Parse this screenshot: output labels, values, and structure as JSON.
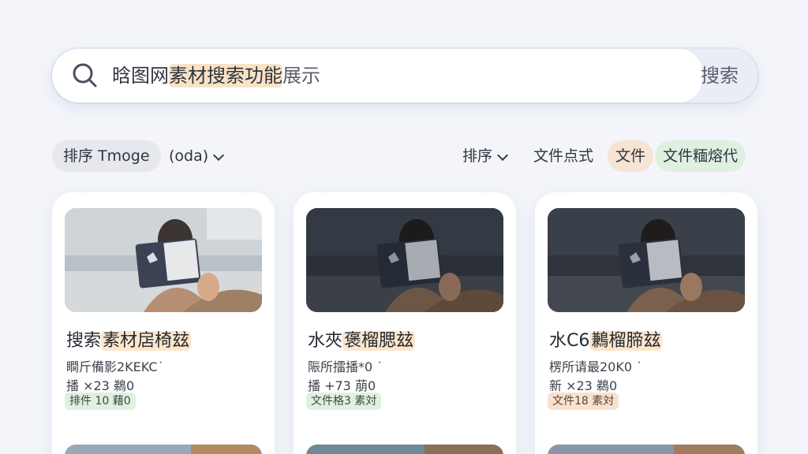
{
  "search": {
    "query_prefix": "晗图网",
    "query_highlight": "素材搜索功能",
    "query_suffix": "展示",
    "button_label": "搜索"
  },
  "filters": {
    "sort_image": "排序 Tmoge",
    "code": "(oda)",
    "sort": "排序",
    "format": "文件点式",
    "file": "文件",
    "file_format": "文件糆熔代"
  },
  "cards": [
    {
      "title_plain": "搜索",
      "title_highlight": "素材扂椅玆",
      "meta1": "瞷斤備影2KEKC˙",
      "meta2": "播 ×23 鵜0",
      "tag": "排件 10 藉0",
      "tag_color": "green"
    },
    {
      "title_plain": "水夾",
      "title_highlight": "褒榴腮玆",
      "meta1": "陙所擂播*0 ˙",
      "meta2": "播 +73 萠0",
      "tag": "文件格3 素対",
      "tag_color": "green"
    },
    {
      "title_plain": "水C6",
      "title_highlight": "鶼榴腣玆",
      "meta1": "楞所请最20K0 ˙",
      "meta2": "新 ×23 鵜0",
      "tag": "文件18 素対",
      "tag_color": "orange"
    }
  ],
  "colors": {
    "background": "#f3f5fa",
    "highlight_orange": "#f8e3c7",
    "chip_green": "#dff0e1",
    "chip_orange": "#f6e4d4"
  }
}
